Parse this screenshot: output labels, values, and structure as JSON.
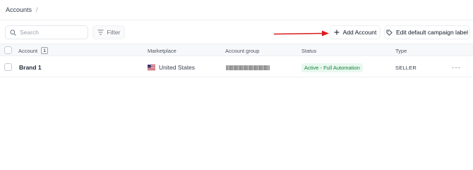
{
  "breadcrumb": {
    "items": [
      "Accounts"
    ],
    "separator": "/"
  },
  "toolbar": {
    "search_placeholder": "Search",
    "filter_label": "Filter",
    "add_label": "Add Account",
    "edit_label": "Edit default campaign label"
  },
  "table": {
    "columns": {
      "account": "Account",
      "marketplace": "Marketplace",
      "group": "Account group",
      "status": "Status",
      "type": "Type"
    },
    "count": "1",
    "rows": [
      {
        "account": "Brand 1",
        "marketplace": "United States",
        "status": "Active - Full Automation",
        "type": "SELLER",
        "more": "···"
      }
    ]
  },
  "colors": {
    "annotation_arrow": "#d91c1c",
    "status_bg": "#e9f8ef",
    "status_text": "#15803d"
  }
}
